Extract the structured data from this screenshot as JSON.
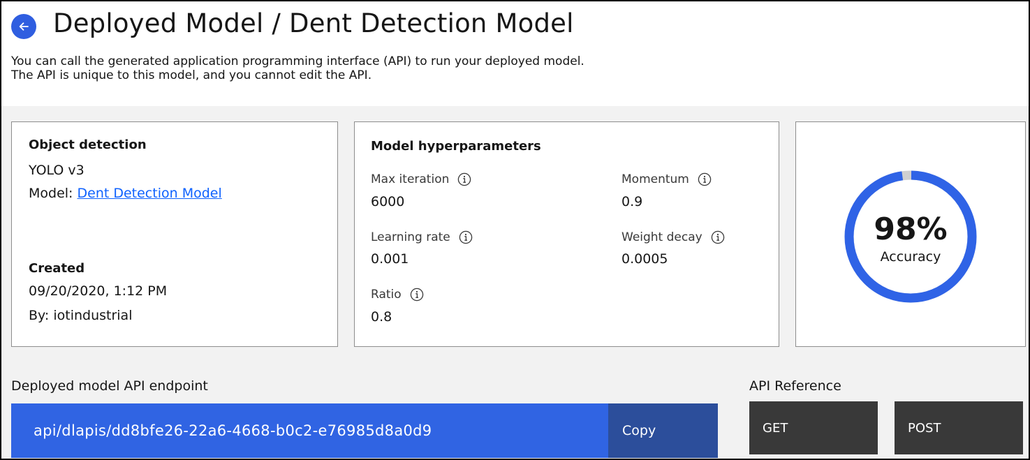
{
  "header": {
    "title": "Deployed Model / Dent Detection Model",
    "description_line1": "You can call the generated application programming interface (API) to run your deployed model.",
    "description_line2": "The API is unique to this model, and you cannot edit the API.",
    "back_icon": "arrow-left-icon"
  },
  "info_card": {
    "heading": "Object detection",
    "algorithm": "YOLO v3",
    "model_prefix": "Model: ",
    "model_link": "Dent Detection Model",
    "created_heading": "Created",
    "created_date": "09/20/2020, 1:12 PM",
    "created_by": "By: iotindustrial"
  },
  "hyperparameters": {
    "heading": "Model hyperparameters",
    "info_icon": "information-icon",
    "items": [
      {
        "label": "Max iteration",
        "value": "6000"
      },
      {
        "label": "Momentum",
        "value": "0.9"
      },
      {
        "label": "Learning rate",
        "value": "0.001"
      },
      {
        "label": "Weight decay",
        "value": "0.0005"
      },
      {
        "label": "Ratio",
        "value": "0.8"
      }
    ]
  },
  "accuracy": {
    "value_text": "98%",
    "fraction": 0.98,
    "label": "Accuracy",
    "ring_color": "#2f63e6",
    "track_color": "#d0d0d0"
  },
  "endpoint": {
    "title": "Deployed model API endpoint",
    "url": "api/dlapis/dd8bfe26-22a6-4668-b0c2-e76985d8a0d9",
    "copy_label": "Copy"
  },
  "api_reference": {
    "title": "API Reference",
    "get_label": "GET",
    "post_label": "POST"
  },
  "colors": {
    "accent": "#2f5ee0",
    "endpoint_bg": "#3064e3",
    "copy_bg": "#2c4e9b",
    "method_bg": "#393939",
    "link": "#0f62fe"
  }
}
